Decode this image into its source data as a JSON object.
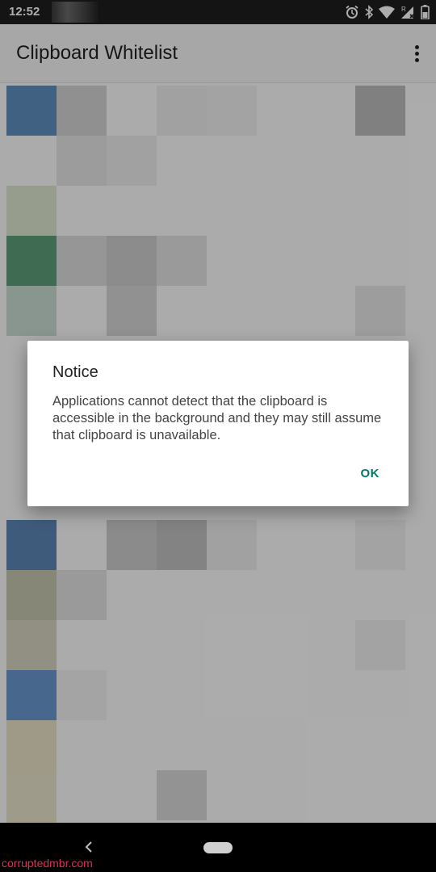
{
  "status_bar": {
    "time": "12:52"
  },
  "app_bar": {
    "title": "Clipboard Whitelist"
  },
  "dialog": {
    "title": "Notice",
    "message": "Applications cannot detect that the clipboard is accessible in the background and they may still assume that clipboard is unavailable.",
    "ok_label": "OK"
  },
  "watermark": "corruptedmbr.com",
  "colors": {
    "accent": "#00796b",
    "scrim": "rgba(0,0,0,0.32)"
  }
}
